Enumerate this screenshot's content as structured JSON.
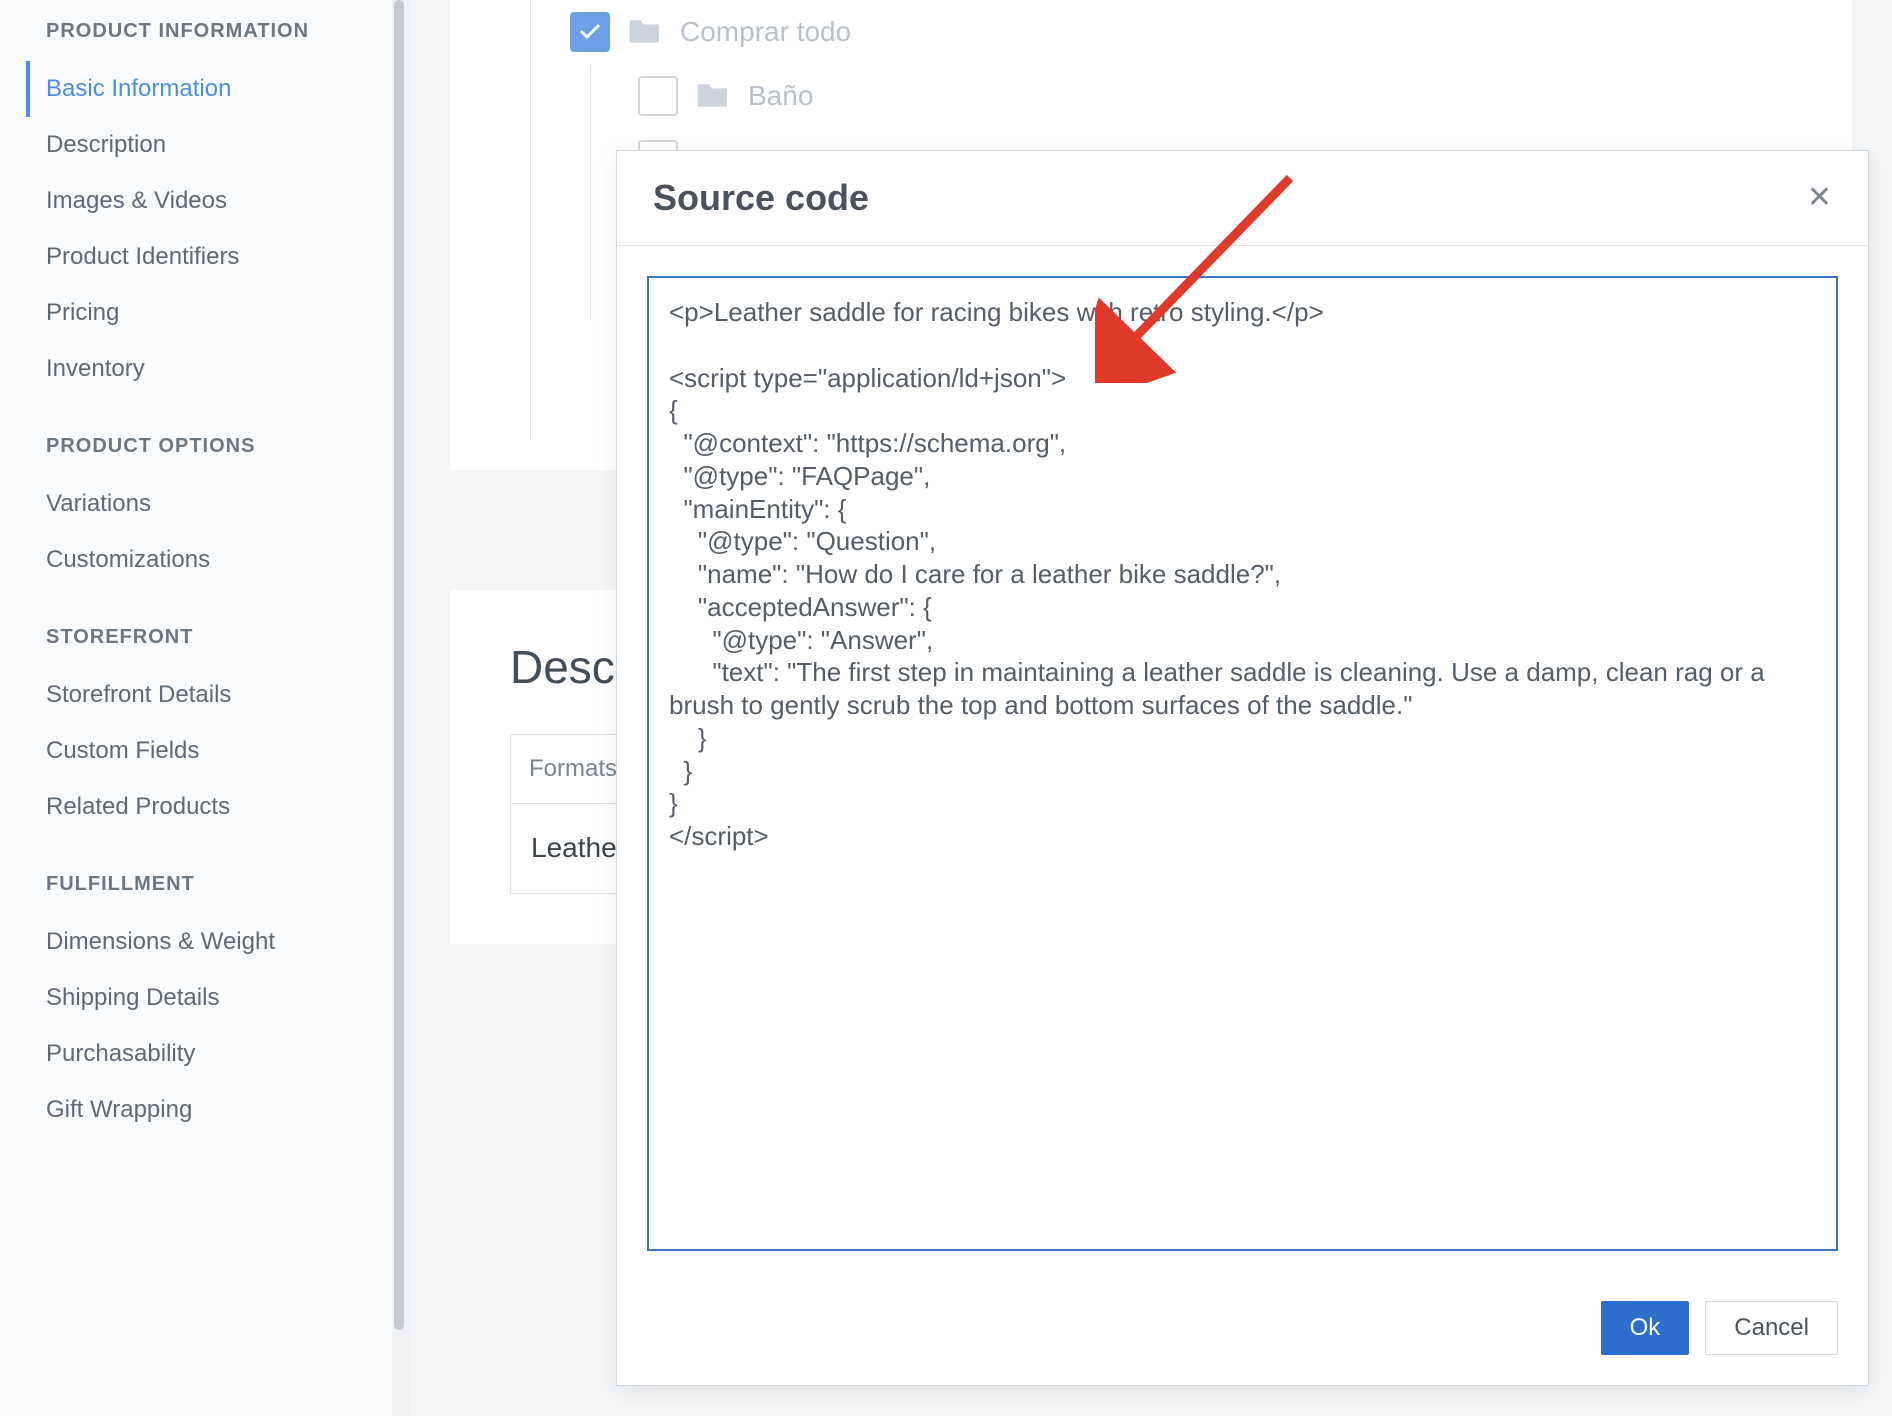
{
  "sidebar": {
    "groups": [
      {
        "title": "PRODUCT INFORMATION",
        "items": [
          {
            "label": "Basic Information",
            "active": true
          },
          {
            "label": "Description"
          },
          {
            "label": "Images & Videos"
          },
          {
            "label": "Product Identifiers"
          },
          {
            "label": "Pricing"
          },
          {
            "label": "Inventory"
          }
        ]
      },
      {
        "title": "PRODUCT OPTIONS",
        "items": [
          {
            "label": "Variations"
          },
          {
            "label": "Customizations"
          }
        ]
      },
      {
        "title": "STOREFRONT",
        "items": [
          {
            "label": "Storefront Details"
          },
          {
            "label": "Custom Fields"
          },
          {
            "label": "Related Products"
          }
        ]
      },
      {
        "title": "FULFILLMENT",
        "items": [
          {
            "label": "Dimensions & Weight"
          },
          {
            "label": "Shipping Details"
          },
          {
            "label": "Purchasability"
          },
          {
            "label": "Gift Wrapping"
          }
        ]
      }
    ]
  },
  "tree": {
    "row0": {
      "label": "Comprar todo",
      "checked": true
    },
    "row1": {
      "label": "Baño",
      "checked": false
    }
  },
  "description": {
    "title_partial": "Descri",
    "toolbar": {
      "formats": "Formats"
    },
    "body_partial": "Leather"
  },
  "modal": {
    "title": "Source code",
    "code": "<p>Leather saddle for racing bikes with retro styling.</p>\n\n<script type=\"application/ld+json\">\n{\n  \"@context\": \"https://schema.org\",\n  \"@type\": \"FAQPage\",\n  \"mainEntity\": {\n    \"@type\": \"Question\",\n    \"name\": \"How do I care for a leather bike saddle?\",\n    \"acceptedAnswer\": {\n      \"@type\": \"Answer\",\n      \"text\": \"The first step in maintaining a leather saddle is cleaning. Use a damp, clean rag or a brush to gently scrub the top and bottom surfaces of the saddle.\"\n    }\n  }\n}\n</script>",
    "ok": "Ok",
    "cancel": "Cancel"
  },
  "annotation": {
    "arrow_color": "#e03a2a"
  }
}
